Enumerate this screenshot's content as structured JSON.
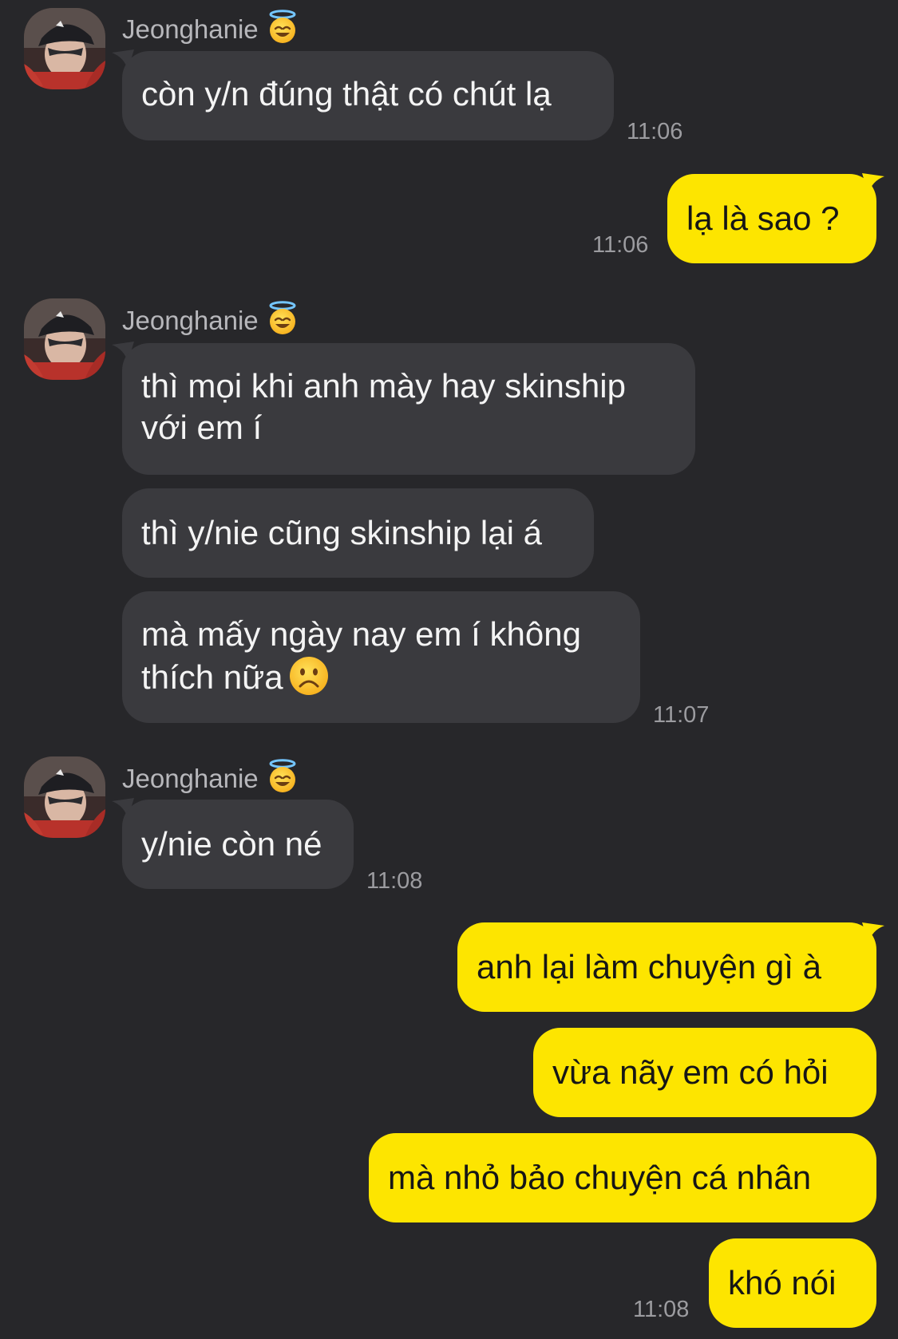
{
  "chat": {
    "sender_name": "Jeonghanie",
    "groups": [
      {
        "sender": "Jeonghanie",
        "messages": [
          "còn y/n đúng thật có chút lạ"
        ],
        "time": "11:06"
      },
      {
        "sender": "me",
        "messages": [
          "lạ là sao ?"
        ],
        "time": "11:06"
      },
      {
        "sender": "Jeonghanie",
        "messages": [
          "thì mọi khi anh mày hay skinship",
          "với em í",
          "thì y/nie cũng skinship lại á",
          "mà mấy ngày nay em í không",
          "thích nữa"
        ],
        "time": "11:07"
      },
      {
        "sender": "Jeonghanie",
        "messages": [
          "y/nie còn né"
        ],
        "time": "11:08"
      },
      {
        "sender": "me",
        "messages": [
          "anh lại làm chuyện gì à",
          "vừa nãy em có hỏi",
          "mà nhỏ bảo chuyện cá nhân",
          "khó nói"
        ],
        "time": "11:08"
      }
    ]
  },
  "icons": {
    "sender_badge": "smiling-face-with-halo-icon",
    "emoji_in_message": "frowning-face-icon",
    "avatar": "profile-photo"
  },
  "colors": {
    "background": "#27272a",
    "incoming_bubble": "#3a3a3e",
    "outgoing_bubble": "#fde500",
    "incoming_text": "#f4f4f4",
    "outgoing_text": "#161616",
    "timestamp": "#9c9ca0"
  }
}
